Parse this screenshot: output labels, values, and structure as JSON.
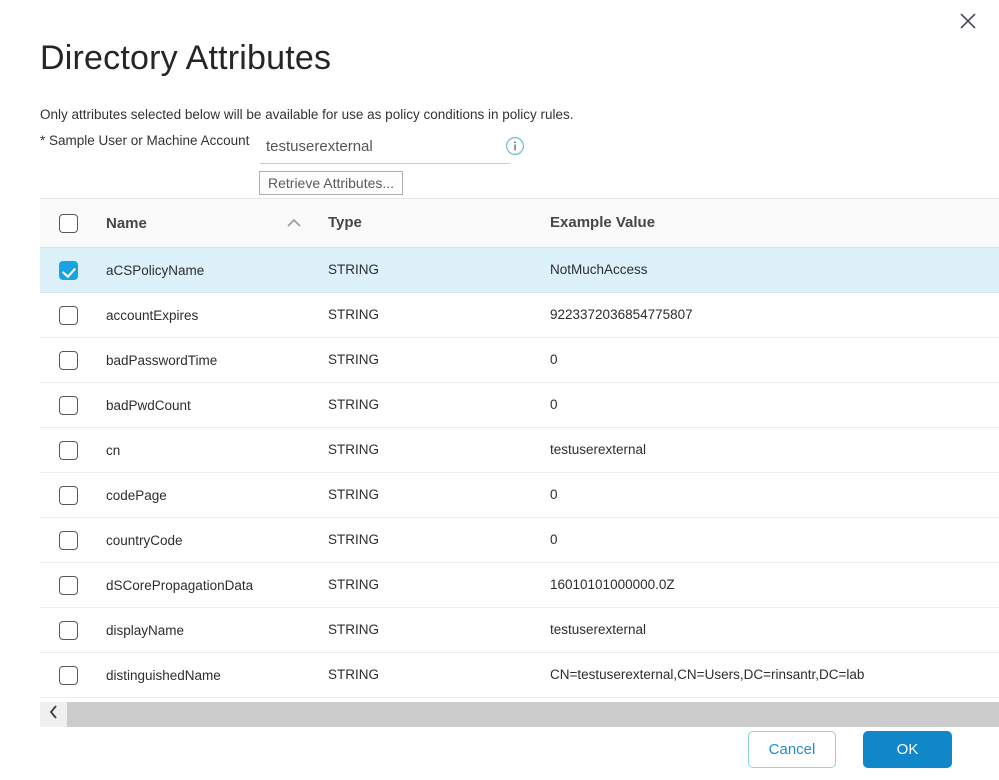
{
  "dialog": {
    "title": "Directory Attributes",
    "close_icon": "close-icon",
    "description": "Only attributes selected below will be available for use as policy conditions in policy rules."
  },
  "form": {
    "label": "* Sample User or Machine Account",
    "sample_account_value": "testuserexternal",
    "sample_account_placeholder": "testuserexternal",
    "info_icon": "info-circle-icon",
    "retrieve_button": "Retrieve Attributes..."
  },
  "table": {
    "select_all_checked": false,
    "sort_icon": "chevron-up-icon",
    "sort_column": "Name",
    "columns": [
      "Name",
      "Type",
      "Example Value"
    ],
    "rows": [
      {
        "checked": true,
        "name": "aCSPolicyName",
        "type": "STRING",
        "value": "NotMuchAccess"
      },
      {
        "checked": false,
        "name": "accountExpires",
        "type": "STRING",
        "value": "9223372036854775807"
      },
      {
        "checked": false,
        "name": "badPasswordTime",
        "type": "STRING",
        "value": "0"
      },
      {
        "checked": false,
        "name": "badPwdCount",
        "type": "STRING",
        "value": "0"
      },
      {
        "checked": false,
        "name": "cn",
        "type": "STRING",
        "value": "testuserexternal"
      },
      {
        "checked": false,
        "name": "codePage",
        "type": "STRING",
        "value": "0"
      },
      {
        "checked": false,
        "name": "countryCode",
        "type": "STRING",
        "value": "0"
      },
      {
        "checked": false,
        "name": "dSCorePropagationData",
        "type": "STRING",
        "value": "16010101000000.0Z"
      },
      {
        "checked": false,
        "name": "displayName",
        "type": "STRING",
        "value": "testuserexternal"
      },
      {
        "checked": false,
        "name": "distinguishedName",
        "type": "STRING",
        "value": "CN=testuserexternal,CN=Users,DC=rinsantr,DC=lab"
      }
    ]
  },
  "scrollbar": {
    "left_arrow_icon": "chevron-left-icon"
  },
  "footer": {
    "cancel_label": "Cancel",
    "ok_label": "OK"
  },
  "colors": {
    "accent_blue": "#0f87c8",
    "checkbox_blue": "#18a4e0",
    "selected_row": "#ddf1fb",
    "cancel_border": "#8fd0ea"
  }
}
